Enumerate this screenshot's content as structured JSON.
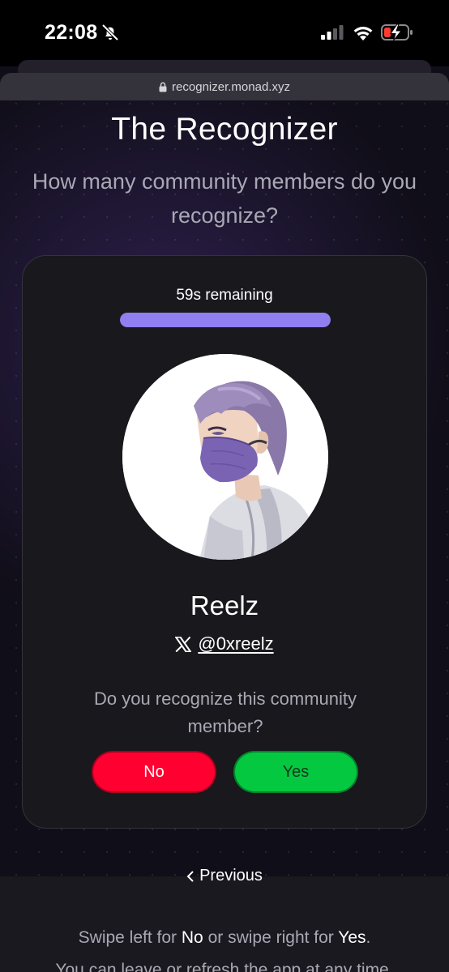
{
  "status_bar": {
    "time": "22:08",
    "icons": [
      "bell-off-icon",
      "signal-icon",
      "wifi-icon",
      "battery-charging-icon"
    ],
    "battery_color": "#ff3b30"
  },
  "browser": {
    "url": "recognizer.monad.xyz",
    "lock_icon": "lock-icon"
  },
  "page": {
    "title": "The Recognizer",
    "subtitle": "How many community members do you recognize?"
  },
  "card": {
    "timer_text": "59s remaining",
    "timer_progress_fraction": 1.0,
    "progress_color": "#8f7ff0",
    "member": {
      "name": "Reelz",
      "platform_icon": "x-logo-icon",
      "handle": "@0xreelz"
    },
    "question": "Do you recognize this community member?",
    "buttons": {
      "no": "No",
      "yes": "Yes",
      "no_color": "#ff0030",
      "yes_color": "#04c83f"
    }
  },
  "navigation": {
    "previous_label": "Previous",
    "previous_icon": "chevron-left-icon"
  },
  "instructions": {
    "line1_a": "Swipe left for ",
    "line1_no": "No",
    "line1_b": " or swipe right for ",
    "line1_yes": "Yes",
    "line1_c": ".",
    "line2": "You can leave or refresh the app at any time."
  }
}
